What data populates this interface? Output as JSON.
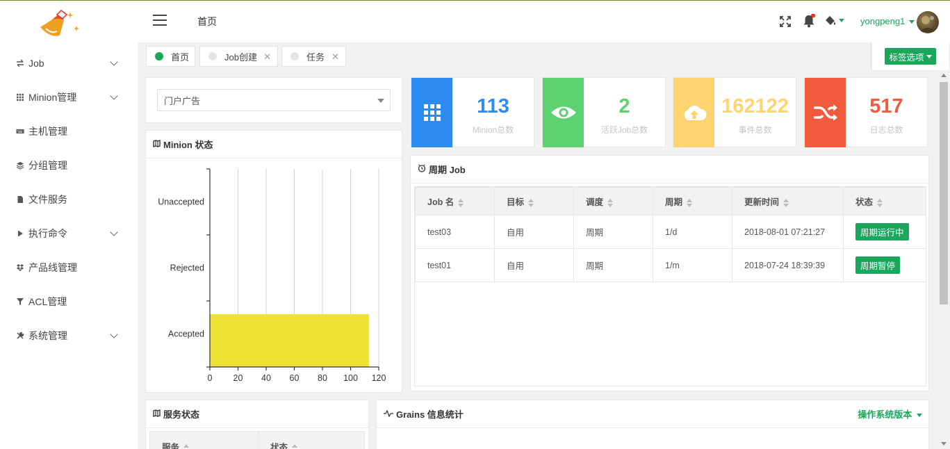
{
  "header": {
    "title": "首页",
    "user_name": "yongpeng1"
  },
  "sidebar": {
    "items": [
      {
        "label": "Job",
        "icon": "exchange-icon",
        "has_children": true
      },
      {
        "label": "Minion管理",
        "icon": "grid-icon",
        "has_children": true
      },
      {
        "label": "主机管理",
        "icon": "keyboard-icon",
        "has_children": false
      },
      {
        "label": "分组管理",
        "icon": "layers-icon",
        "has_children": false
      },
      {
        "label": "文件服务",
        "icon": "file-icon",
        "has_children": false
      },
      {
        "label": "执行命令",
        "icon": "play-icon",
        "has_children": true
      },
      {
        "label": "产品线管理",
        "icon": "dropbox-icon",
        "has_children": false
      },
      {
        "label": "ACL管理",
        "icon": "filter-icon",
        "has_children": false
      },
      {
        "label": "系统管理",
        "icon": "tools-icon",
        "has_children": true
      }
    ]
  },
  "tabs": [
    {
      "label": "首页",
      "active": true,
      "closable": false
    },
    {
      "label": "Job创建",
      "active": false,
      "closable": true
    },
    {
      "label": "任务",
      "active": false,
      "closable": true
    }
  ],
  "tab_options_label": "标签选项",
  "product_select": {
    "value": "门户广告"
  },
  "stats": [
    {
      "value": "113",
      "label": "Minion总数",
      "color": "#2d8cf0",
      "icon": "grid-icon"
    },
    {
      "value": "2",
      "label": "活跃Job总数",
      "color": "#5bd26f",
      "icon": "eye-icon"
    },
    {
      "value": "162122",
      "label": "事件总数",
      "color": "#ffd470",
      "icon": "cloud-upload-icon"
    },
    {
      "value": "517",
      "label": "日志总数",
      "color": "#f05a3d",
      "icon": "shuffle-icon"
    }
  ],
  "minion_status": {
    "title": "Minion 状态"
  },
  "chart_data": {
    "type": "bar",
    "orientation": "horizontal",
    "categories": [
      "Unaccepted",
      "Rejected",
      "Accepted"
    ],
    "values": [
      0,
      0,
      113
    ],
    "xlim": [
      0,
      120
    ],
    "xticks": [
      0,
      20,
      40,
      60,
      80,
      100,
      120
    ],
    "grid": true,
    "bar_color": "#efe234"
  },
  "periodic_job": {
    "title": "周期 Job",
    "columns": [
      "Job 名",
      "目标",
      "调度",
      "周期",
      "更新时间",
      "状态"
    ],
    "rows": [
      [
        "test03",
        "自用",
        "周期",
        "1/d",
        "2018-08-01 07:21:27",
        "周期运行中"
      ],
      [
        "test01",
        "自用",
        "周期",
        "1/m",
        "2018-07-24 18:39:39",
        "周期暂停"
      ]
    ]
  },
  "service_status": {
    "title": "服务状态",
    "columns": [
      "服务",
      "状态"
    ]
  },
  "grains": {
    "title": "Grains 信息统计",
    "dropdown_label": "操作系统版本"
  }
}
